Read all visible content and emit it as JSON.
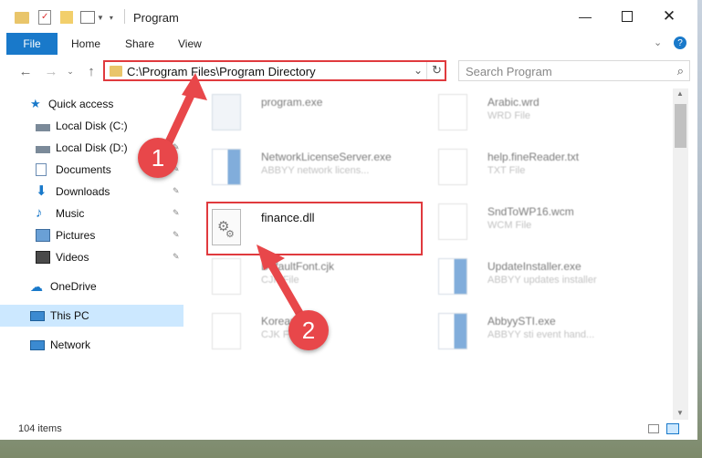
{
  "window": {
    "title": "Program"
  },
  "ribbon": {
    "file": "File",
    "home": "Home",
    "share": "Share",
    "view": "View"
  },
  "address": {
    "path": "C:\\Program Files\\Program Directory"
  },
  "search": {
    "placeholder": "Search Program"
  },
  "nav": {
    "quick_access": "Quick access",
    "local_c": "Local Disk (C:)",
    "local_d": "Local Disk (D:)",
    "documents": "Documents",
    "downloads": "Downloads",
    "music": "Music",
    "pictures": "Pictures",
    "videos": "Videos",
    "onedrive": "OneDrive",
    "this_pc": "This PC",
    "network": "Network"
  },
  "files": {
    "f1": {
      "name": "program.exe",
      "desc": ""
    },
    "f2": {
      "name": "Arabic.wrd",
      "desc": "WRD File"
    },
    "f3": {
      "name": "NetworkLicenseServer.exe",
      "desc": "ABBYY network licens..."
    },
    "f4": {
      "name": "help.fineReader.txt",
      "desc": "TXT File"
    },
    "f5": {
      "name": "finance.dll",
      "desc": ""
    },
    "f6": {
      "name": "SndToWP16.wcm",
      "desc": "WCM File"
    },
    "f7": {
      "name": "DefaultFont.cjk",
      "desc": "CJK File"
    },
    "f8": {
      "name": "UpdateInstaller.exe",
      "desc": "ABBYY updates installer"
    },
    "f9": {
      "name": "Korean...",
      "desc": "CJK File"
    },
    "f10": {
      "name": "AbbyySTI.exe",
      "desc": "ABBYY sti event hand..."
    }
  },
  "status": {
    "items": "104 items"
  },
  "annotations": {
    "one": "1",
    "two": "2"
  },
  "colors": {
    "accent": "#1979ca",
    "highlight": "#e03a3e",
    "selected": "#cce8ff"
  }
}
